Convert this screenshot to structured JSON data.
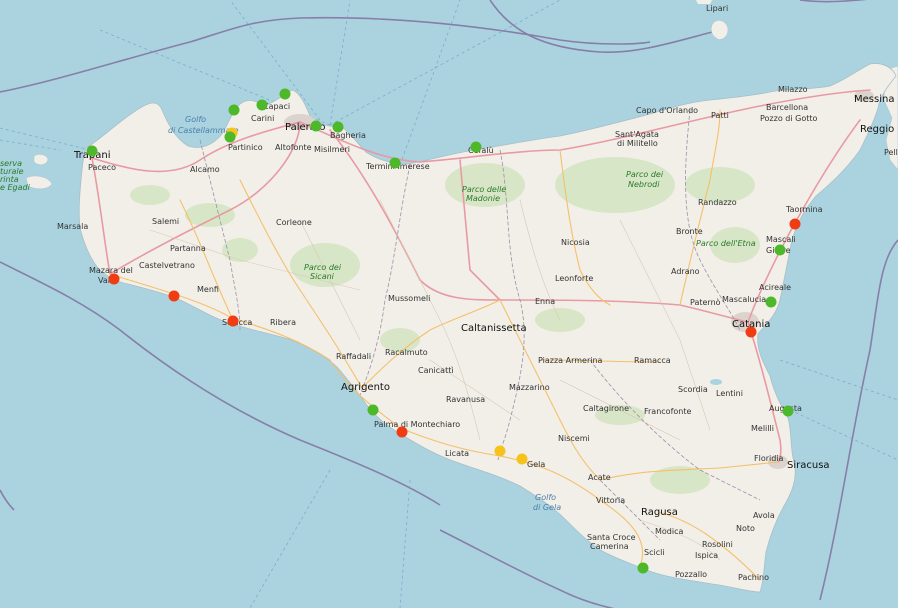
{
  "colors": {
    "sea": "#aad3df",
    "land": "#f2efe9",
    "green_dot": "#4cb82a",
    "red_dot": "#f03c12",
    "yellow_dot": "#f6c31a",
    "boundary": "#7e6a9b",
    "forest": "#cfe3bb"
  },
  "labels": {
    "lipari": "Lipari",
    "milazzo": "Milazzo",
    "barcellona": "Barcellona",
    "pozzo_di_gotto": "Pozzo di Gotto",
    "messina": "Messina",
    "reggio": "Reggio Cal",
    "pell": "Pell",
    "capo_d_orlando": "Capo d'Orlando",
    "patti": "Patti",
    "sant_agata": "Sant'Agata",
    "di_militello": "di Militello",
    "trapani": "Trapani",
    "paceco": "Paceco",
    "riserva_1": "serva",
    "riserva_2": "turale",
    "riserva_3": "rinta",
    "riserva_4": "e Egadi",
    "capaci": "Capaci",
    "carini": "Carini",
    "golfo_castellammare_1": "Golfo",
    "golfo_castellammare_2": "di Castellammare",
    "palermo": "Palermo",
    "bagheria": "Bagheria",
    "misilmeri": "Misilmeri",
    "partinico": "Partinico",
    "altofonte": "Altofonte",
    "alcamo": "Alcamo",
    "termini": "Termini Imerese",
    "cefalu": "Cefalù",
    "parco_madonie_1": "Parco delle",
    "parco_madonie_2": "Madonie",
    "parco_nebrodi_1": "Parco dei",
    "parco_nebrodi_2": "Nebrodi",
    "randazzo": "Randazzo",
    "taormina": "Taormina",
    "calatafimi": "Castelvetrano",
    "salemi": "Salemi",
    "marsala": "Marsala",
    "corleone": "Corleone",
    "partanna": "Partanna",
    "mazara_1": "Mazara del",
    "mazara_2": "Vallo",
    "menfi": "Menfi",
    "sciacca": "Sciacca",
    "ribera": "Ribera",
    "parco_sicani_1": "Parco dei",
    "parco_sicani_2": "Sicani",
    "nicosia": "Nicosia",
    "bronte": "Bronte",
    "parco_etna": "Parco dell'Etna",
    "mascali": "Mascali",
    "giarre": "Giarre",
    "leonforte": "Leonforte",
    "adrano": "Adrano",
    "acireale": "Acireale",
    "mussomeli": "Mussomeli",
    "enna": "Enna",
    "paterno": "Paternò",
    "mascalucia": "Mascalucia",
    "catania": "Catania",
    "caltanissetta": "Caltanissetta",
    "raffadali": "Raffadali",
    "racalmuto": "Racalmuto",
    "piazza_armerina": "Piazza Armerina",
    "ramacca": "Ramacca",
    "agrigento": "Agrigento",
    "canicatti": "Canicattì",
    "mazzarino": "Mazzarino",
    "scordia": "Scordia",
    "ravanusa": "Ravanusa",
    "lentini": "Lentini",
    "francofonte": "Francofonte",
    "caltagirone": "Caltagirone",
    "palma": "Palma di Montechiaro",
    "augusta": "Augusta",
    "melilli": "Melilli",
    "niscemi": "Niscemi",
    "licata": "Licata",
    "gela": "Gela",
    "floridia": "Floridia",
    "siracusa": "Siracusa",
    "acate": "Acate",
    "golfo_gela_1": "Golfo",
    "golfo_gela_2": "di Gela",
    "vittoria": "Vittoria",
    "ragusa": "Ragusa",
    "avola": "Avola",
    "modica": "Modica",
    "noto": "Noto",
    "santa_croce_1": "Santa Croce",
    "santa_croce_2": "Camerina",
    "scicli": "Scicli",
    "rosolini": "Rosolini",
    "ispica": "Ispica",
    "pozzallo": "Pozzallo",
    "pachino": "Pachino"
  },
  "markers": [
    {
      "status": "green"
    },
    {
      "status": "green"
    },
    {
      "status": "green"
    },
    {
      "status": "green"
    },
    {
      "status": "green"
    },
    {
      "status": "green"
    },
    {
      "status": "yellow"
    },
    {
      "status": "green"
    },
    {
      "status": "green"
    },
    {
      "status": "green"
    },
    {
      "status": "red"
    },
    {
      "status": "red"
    },
    {
      "status": "red"
    },
    {
      "status": "green"
    },
    {
      "status": "red"
    },
    {
      "status": "yellow"
    },
    {
      "status": "yellow"
    },
    {
      "status": "green"
    },
    {
      "status": "green"
    },
    {
      "status": "red"
    },
    {
      "status": "green"
    },
    {
      "status": "red"
    },
    {
      "status": "green"
    }
  ]
}
